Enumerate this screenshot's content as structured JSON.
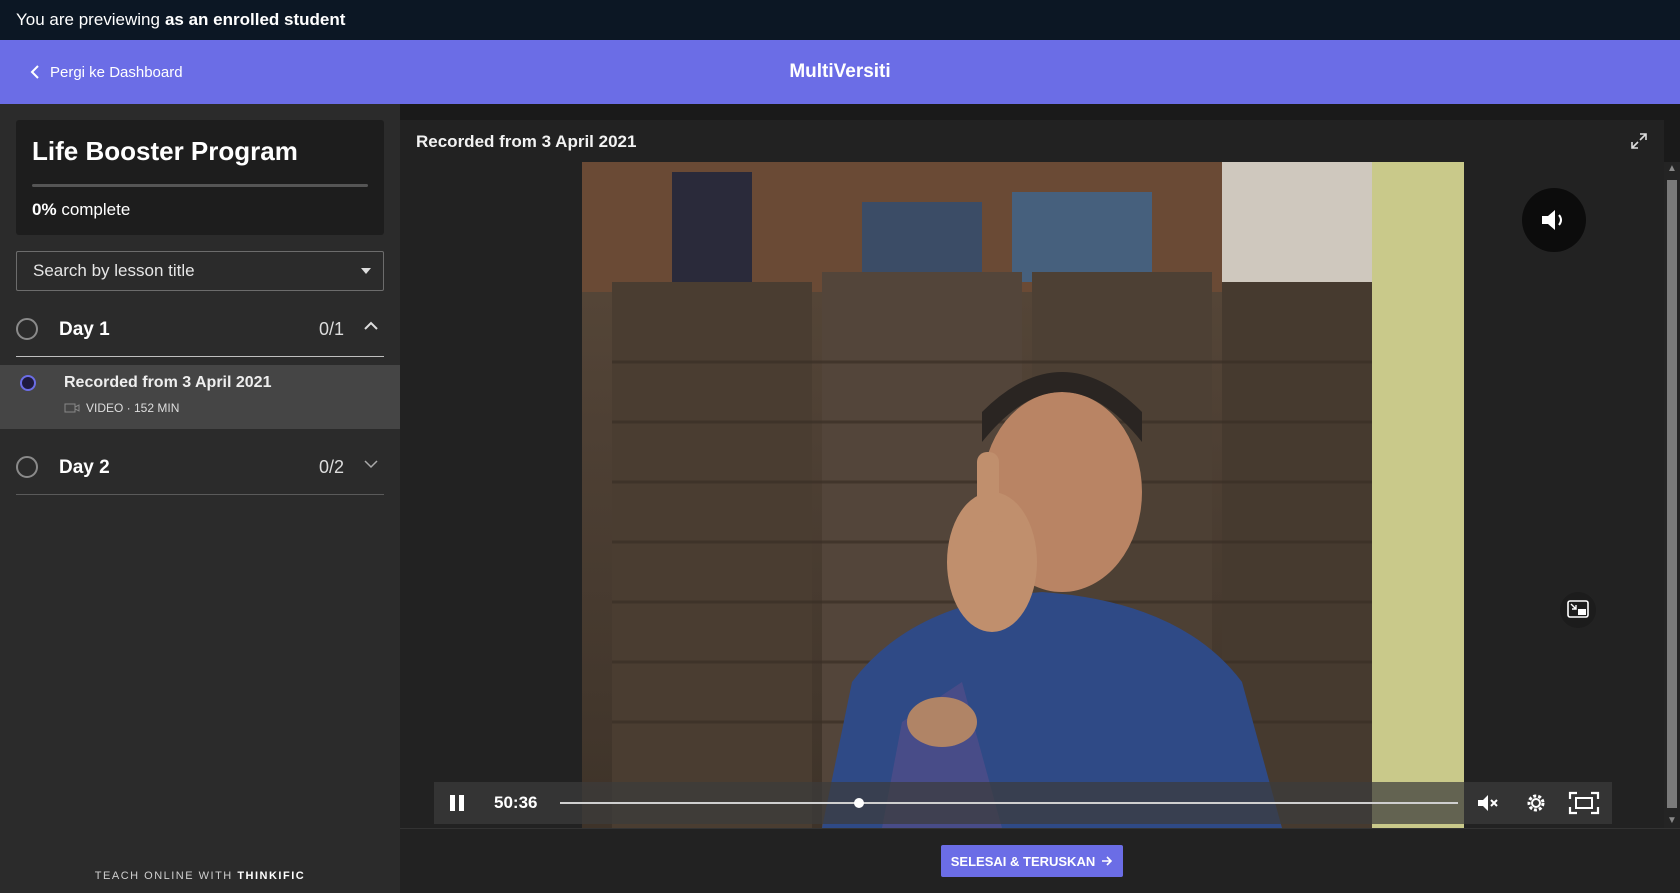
{
  "preview_bar": {
    "prefix": "You are previewing",
    "role": "as an enrolled student"
  },
  "header": {
    "back_label": "Pergi ke Dashboard",
    "brand": "MultiVersiti"
  },
  "sidebar": {
    "course_title": "Life Booster Program",
    "progress": {
      "percent_label": "0%",
      "suffix": "complete",
      "fraction": 0
    },
    "search_placeholder": "Search by lesson title",
    "chapters": [
      {
        "title": "Day 1",
        "count": "0/1",
        "expanded": true,
        "lessons": [
          {
            "title": "Recorded from 3 April 2021",
            "meta": "VIDEO · 152 MIN"
          }
        ]
      },
      {
        "title": "Day 2",
        "count": "0/2",
        "expanded": false
      }
    ],
    "footer": {
      "prefix": "TEACH ONLINE WITH",
      "brand": "THINKIFIC"
    }
  },
  "content": {
    "lesson_title": "Recorded from 3 April 2021",
    "player": {
      "current_time": "50:36",
      "progress_fraction": 0.333
    },
    "cta_label": "SELESAI & TERUSKAN"
  },
  "colors": {
    "accent": "#6b6de6",
    "preview_bar": "#0c1724",
    "sidebar_bg": "#2b2b2b"
  }
}
